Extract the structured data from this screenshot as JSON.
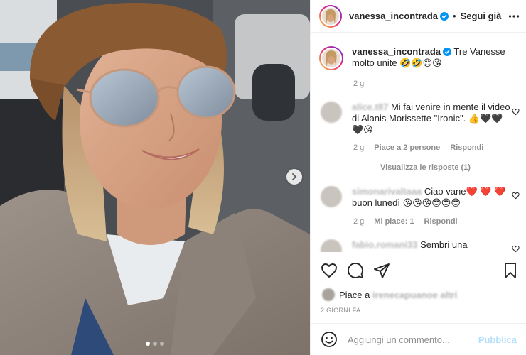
{
  "colors": {
    "accent": "#0095f6",
    "verified": "#0095f6",
    "publish_disabled": "#b2dffc",
    "heart": "#ed4956",
    "muted": "#8e8e8e"
  },
  "post_header": {
    "username": "vanessa_incontrada",
    "separator": "•",
    "follow_label": "Segui già",
    "more_icon": "more-horizontal-icon"
  },
  "caption": {
    "username": "vanessa_incontrada",
    "text": "Tre Vanesse molto unite 🤣🤣😊😘",
    "time": "2 g"
  },
  "comments": [
    {
      "username": "alice.t87",
      "text": "Mi fai venire in mente il video di Alanis Morissette \"Ironic\". 👍🖤🖤🖤😘",
      "time": "2 g",
      "likes": "Piace a 2 persone",
      "reply": "Rispondi"
    },
    {
      "username": "simonarivaltaaa",
      "text": "Ciao vane❤️ ❤️ ❤️ buon lunedì 😘😘😘😍😍😍",
      "time": "2 g",
      "likes": "Mi piace: 1",
      "reply": "Rispondi"
    },
    {
      "username": "fabio.romani33",
      "text": "Sembri una"
    }
  ],
  "view_replies": "Visualizza le risposte (1)",
  "actions": {
    "like_icon": "heart-icon",
    "comment_icon": "comment-icon",
    "share_icon": "send-icon",
    "save_icon": "bookmark-icon"
  },
  "likes": {
    "prefix": "Piace a ",
    "name": "irenecapuano",
    "suffix": " e altri"
  },
  "post_time": "2 GIORNI FA",
  "add_comment": {
    "emoji_icon": "emoji-smile-icon",
    "placeholder": "Aggiungi un commento...",
    "publish_label": "Pubblica"
  },
  "carousel": {
    "next_icon": "chevron-right-icon",
    "slide_count": 3,
    "active_slide": 1
  }
}
